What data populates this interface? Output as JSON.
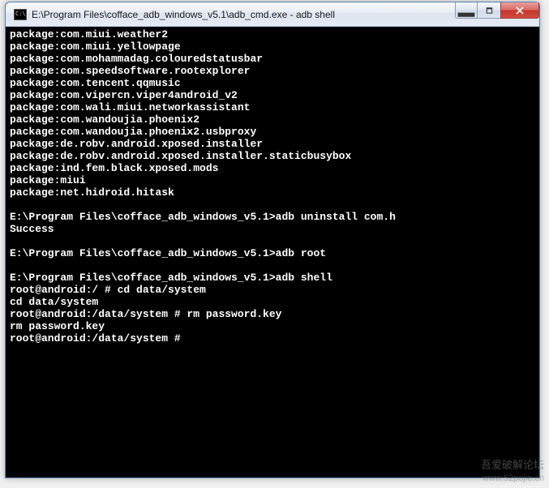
{
  "window": {
    "title": "E:\\Program Files\\cofface_adb_windows_v5.1\\adb_cmd.exe - adb shell"
  },
  "terminal": {
    "lines": [
      "package:com.miui.weather2",
      "package:com.miui.yellowpage",
      "package:com.mohammadag.colouredstatusbar",
      "package:com.speedsoftware.rootexplorer",
      "package:com.tencent.qqmusic",
      "package:com.vipercn.viper4android_v2",
      "package:com.wali.miui.networkassistant",
      "package:com.wandoujia.phoenix2",
      "package:com.wandoujia.phoenix2.usbproxy",
      "package:de.robv.android.xposed.installer",
      "package:de.robv.android.xposed.installer.staticbusybox",
      "package:ind.fem.black.xposed.mods",
      "package:miui",
      "package:net.hidroid.hitask",
      "",
      "E:\\Program Files\\cofface_adb_windows_v5.1>adb uninstall com.h",
      "Success",
      "",
      "E:\\Program Files\\cofface_adb_windows_v5.1>adb root",
      "",
      "E:\\Program Files\\cofface_adb_windows_v5.1>adb shell",
      "root@android:/ # cd data/system",
      "cd data/system",
      "root@android:/data/system # rm password.key",
      "rm password.key",
      "root@android:/data/system #"
    ]
  },
  "watermark": {
    "line1": "吾爱破解论坛",
    "line2": "www.52pojie.cn"
  }
}
